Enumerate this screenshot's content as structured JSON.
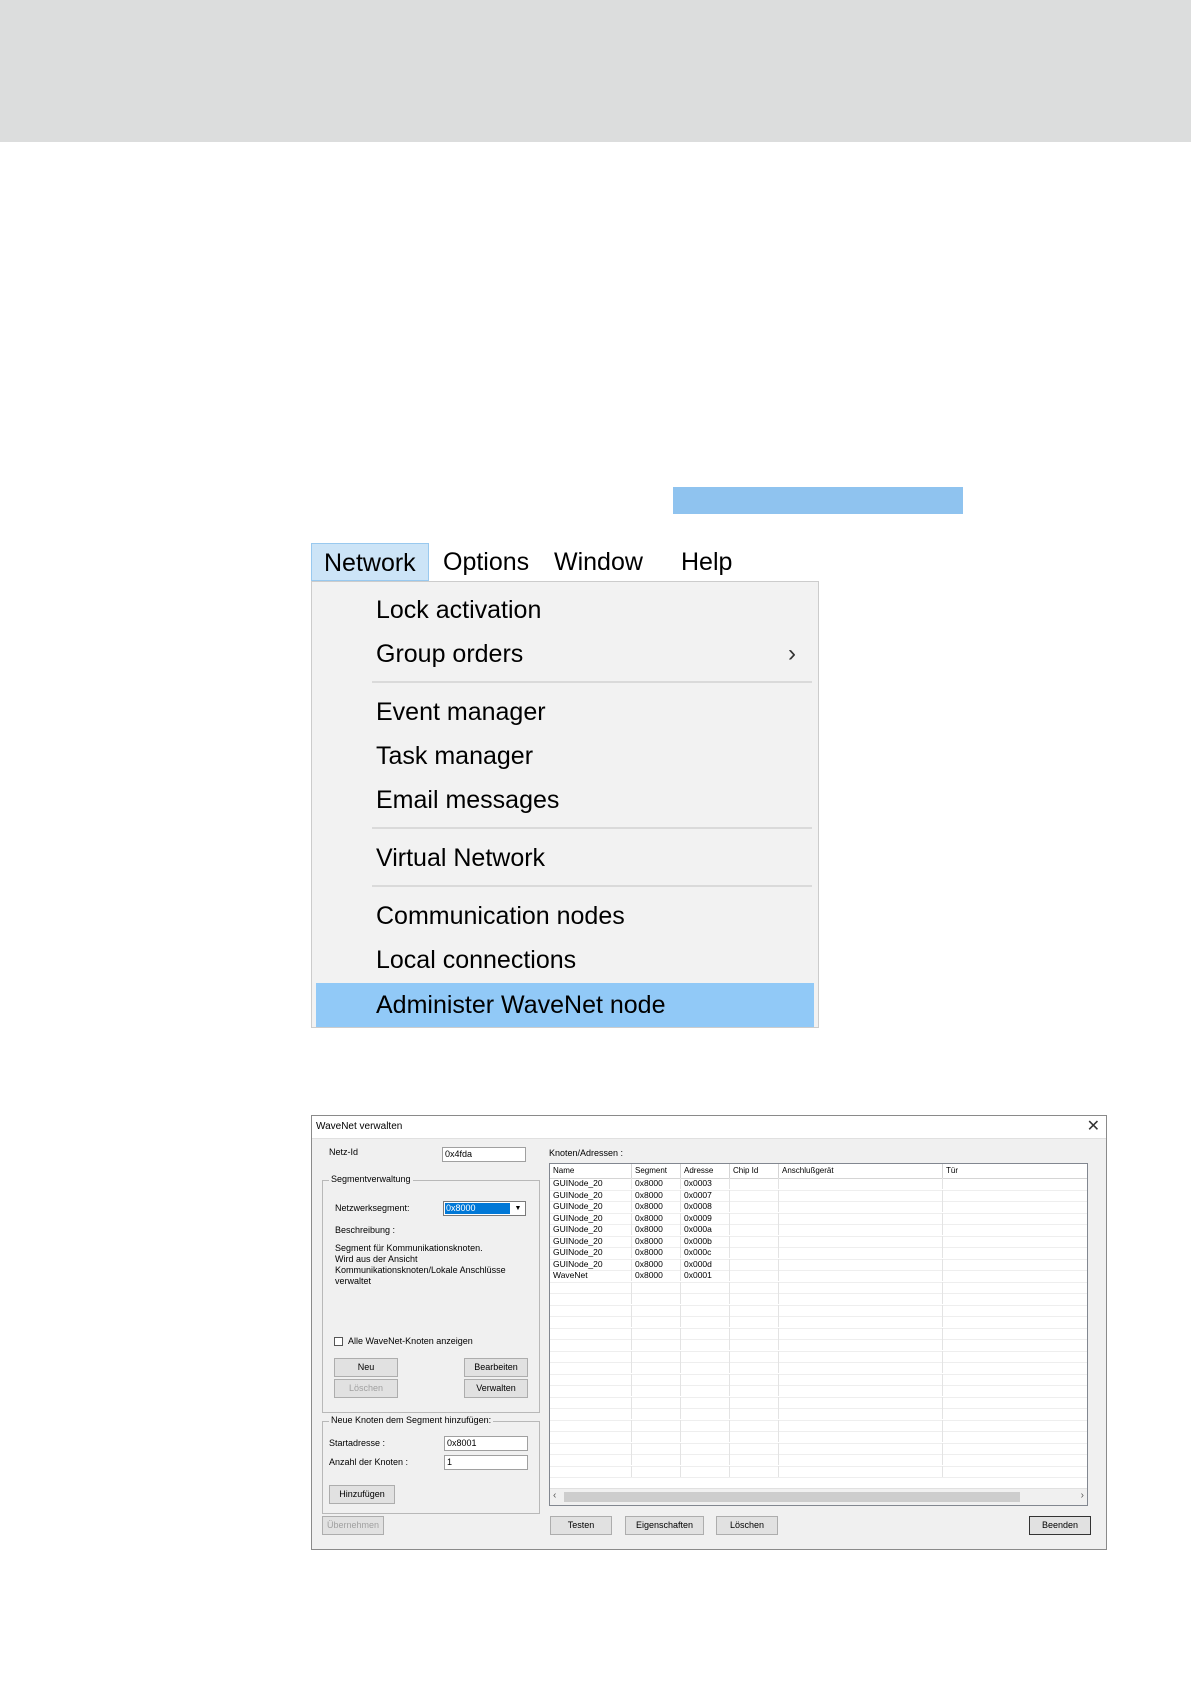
{
  "menu": {
    "menubar": [
      "Network",
      "Options",
      "Window",
      "Help"
    ],
    "items": [
      "Lock activation",
      "Group orders",
      "Event manager",
      "Task manager",
      "Email messages",
      "Virtual Network",
      "Communication nodes",
      "Local connections",
      "Administer WaveNet node"
    ],
    "submenu_indicator": "›",
    "selected_item": "Administer WaveNet node"
  },
  "dialog": {
    "title": "WaveNet verwalten",
    "close_glyph": "✕",
    "netz_id_label": "Netz-Id",
    "netz_id_value": "0x4fda",
    "segment_group_title": "Segmentverwaltung",
    "segment_label": "Netzwerksegment:",
    "segment_value": "0x8000",
    "description_label": "Beschreibung :",
    "description_lines": [
      "Segment für Kommunikationsknoten.",
      "Wird aus der Ansicht",
      "Kommunikationsknoten/Lokale Anschlüsse",
      "verwaltet"
    ],
    "show_all_label": "Alle WaveNet-Knoten anzeigen",
    "buttons": {
      "neu": "Neu",
      "bearbeiten": "Bearbeiten",
      "loeschen_segment": "Löschen",
      "verwalten": "Verwalten",
      "hinzufuegen": "Hinzufügen",
      "uebernehmen": "Übernehmen",
      "testen": "Testen",
      "eigenschaften": "Eigenschaften",
      "loeschen": "Löschen",
      "beenden": "Beenden"
    },
    "add_group_title": "Neue Knoten dem Segment hinzufügen:",
    "start_address_label": "Startadresse :",
    "start_address_value": "0x8001",
    "node_count_label": "Anzahl der Knoten :",
    "node_count_value": "1",
    "table_title": "Knoten/Adressen :",
    "table": {
      "columns": [
        "Name",
        "Segment",
        "Adresse",
        "Chip Id",
        "Anschlußgerät",
        "Tür"
      ],
      "rows": [
        [
          "GUINode_20",
          "0x8000",
          "0x0003",
          "",
          "",
          ""
        ],
        [
          "GUINode_20",
          "0x8000",
          "0x0007",
          "",
          "",
          ""
        ],
        [
          "GUINode_20",
          "0x8000",
          "0x0008",
          "",
          "",
          ""
        ],
        [
          "GUINode_20",
          "0x8000",
          "0x0009",
          "",
          "",
          ""
        ],
        [
          "GUINode_20",
          "0x8000",
          "0x000a",
          "",
          "",
          ""
        ],
        [
          "GUINode_20",
          "0x8000",
          "0x000b",
          "",
          "",
          ""
        ],
        [
          "GUINode_20",
          "0x8000",
          "0x000c",
          "",
          "",
          ""
        ],
        [
          "GUINode_20",
          "0x8000",
          "0x000d",
          "",
          "",
          ""
        ],
        [
          "WaveNet",
          "0x8000",
          "0x0001",
          "",
          "",
          ""
        ]
      ]
    },
    "scroll_left": "‹",
    "scroll_right": "›"
  }
}
